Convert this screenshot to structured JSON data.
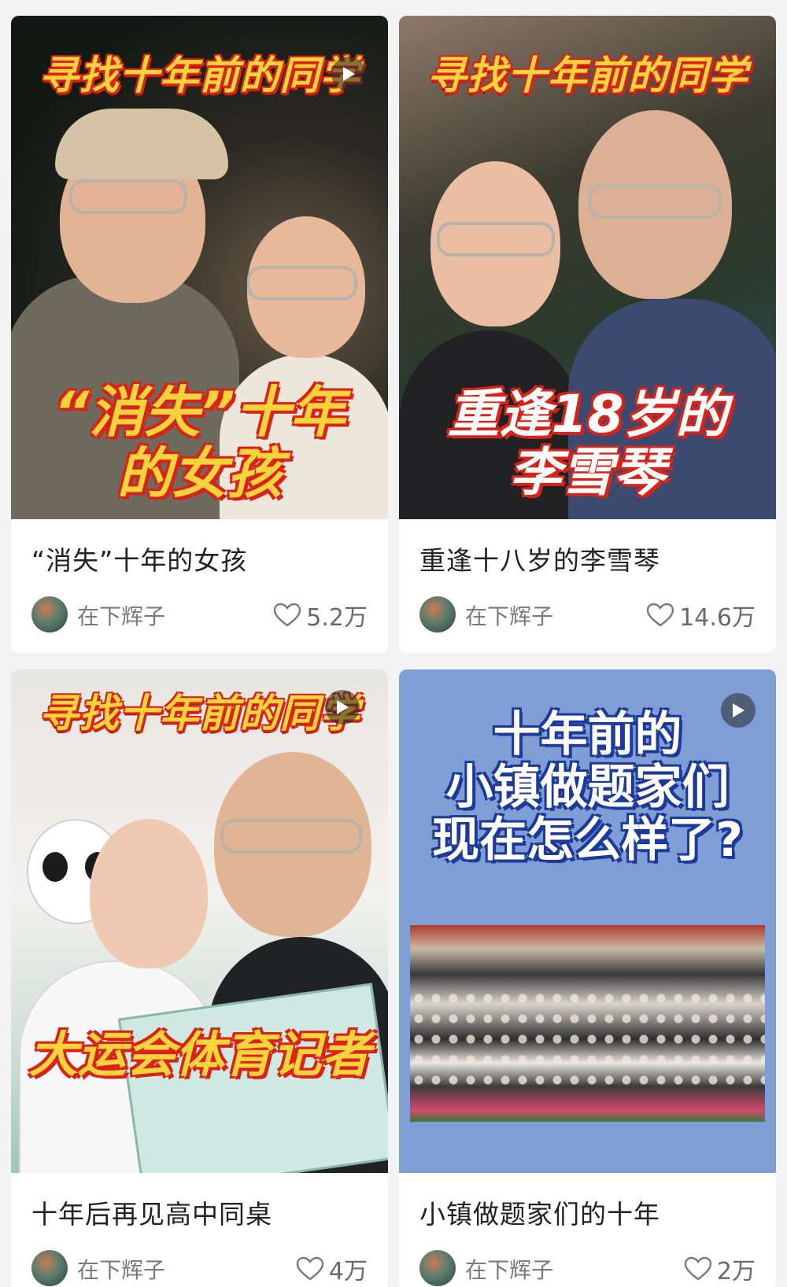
{
  "cards": [
    {
      "banner": "寻找十年前的同学",
      "caption_lines": [
        "“消失”十年",
        "的女孩"
      ],
      "title": "“消失”十年的女孩",
      "author": "在下辉子",
      "likes": "5.2万"
    },
    {
      "banner": "寻找十年前的同学",
      "caption_lines": [
        "重逢18岁的",
        "李雪琴"
      ],
      "title": "重逢十八岁的李雪琴",
      "author": "在下辉子",
      "likes": "14.6万"
    },
    {
      "banner": "寻找十年前的同学",
      "caption_lines": [
        "大运会体育记者"
      ],
      "title": "十年后再见高中同桌",
      "author": "在下辉子",
      "likes": "4万"
    },
    {
      "caption_lines": [
        "十年前的",
        "小镇做题家们",
        "现在怎么样了?"
      ],
      "title": "小镇做题家们的十年",
      "author": "在下辉子",
      "likes": "2万"
    }
  ],
  "icons": {
    "play": "play-icon",
    "like": "heart-outline-icon",
    "avatar": "avatar"
  },
  "colors": {
    "banner_text": "#f7d33c",
    "banner_outline": "#d8231a",
    "blue_card_bg": "#7f9ed6",
    "title_text": "#222222",
    "meta_text": "#7a7a7a"
  }
}
